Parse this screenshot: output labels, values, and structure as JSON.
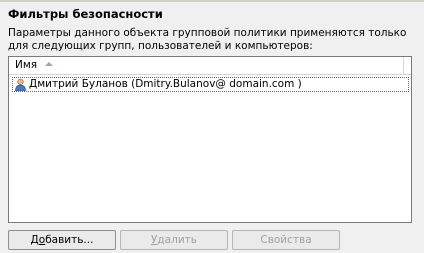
{
  "section": {
    "title": "Фильтры безопасности",
    "description_line1": "Параметры данного объекта групповой политики применяются только",
    "description_line2": "для следующих групп, пользователей и компьютеров:"
  },
  "list": {
    "column_name": "Имя",
    "items": [
      {
        "icon": "user-icon",
        "label": "Дмитрий Буланов (Dmitry.Bulanov@ domain.com )"
      }
    ]
  },
  "buttons": {
    "add_prefix": "Д",
    "add_accel": "о",
    "add_suffix": "бавить...",
    "delete_prefix": "",
    "delete_accel": "У",
    "delete_suffix": "далить",
    "properties": "Свойства"
  }
}
